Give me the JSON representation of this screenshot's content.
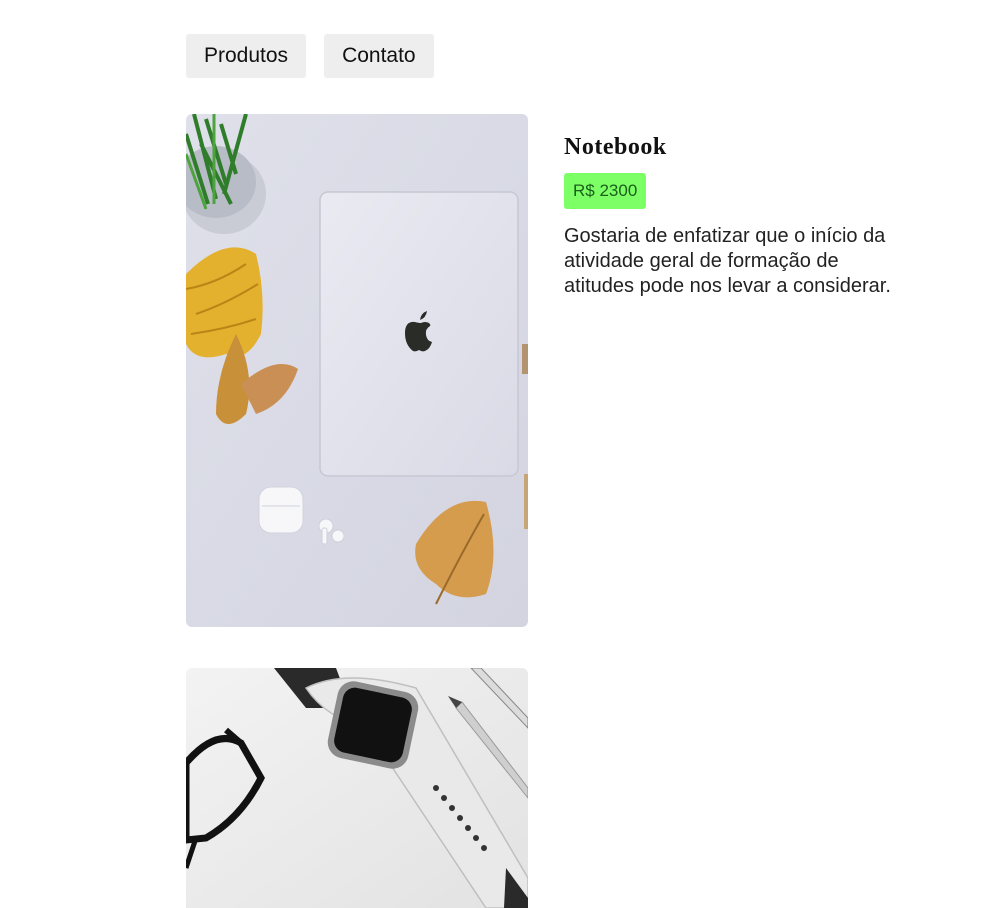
{
  "nav": {
    "items": [
      {
        "label": "Produtos"
      },
      {
        "label": "Contato"
      }
    ]
  },
  "products": [
    {
      "title": "Notebook",
      "price": "R$ 2300",
      "description": "Gostaria de enfatizar que o início da atividade geral de formação de atitudes pode nos levar a considerar.",
      "image": "laptop-photo"
    },
    {
      "image": "smartwatch-photo"
    }
  ],
  "colors": {
    "price_badge_bg": "#7dff66",
    "price_badge_text": "#1a5f1a",
    "nav_button_bg": "#eeeeee"
  }
}
